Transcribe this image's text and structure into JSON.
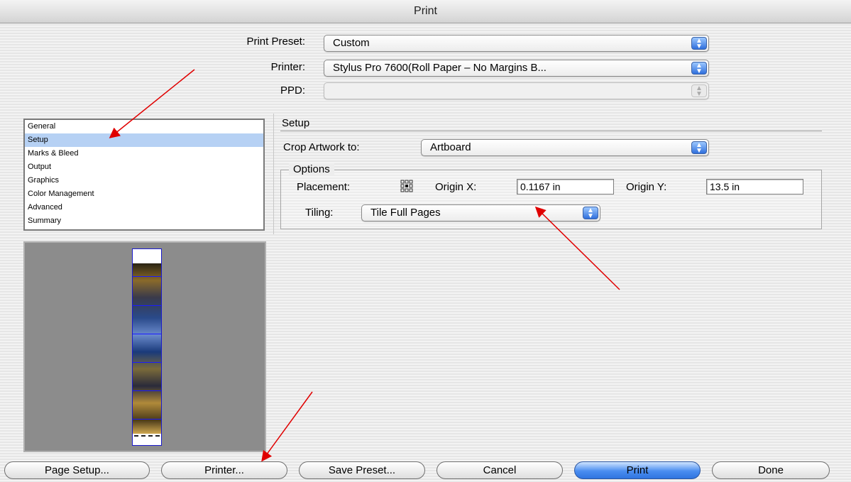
{
  "window": {
    "title": "Print"
  },
  "top": {
    "preset_label": "Print Preset:",
    "preset_value": "Custom",
    "printer_label": "Printer:",
    "printer_value": "Stylus Pro 7600(Roll Paper – No Margins B...",
    "ppd_label": "PPD:",
    "ppd_value": ""
  },
  "sidebar": {
    "items": [
      {
        "label": "General"
      },
      {
        "label": "Setup",
        "selected": true
      },
      {
        "label": "Marks & Bleed"
      },
      {
        "label": "Output"
      },
      {
        "label": "Graphics"
      },
      {
        "label": "Color Management"
      },
      {
        "label": "Advanced"
      },
      {
        "label": "Summary"
      }
    ]
  },
  "setup": {
    "title": "Setup",
    "crop_label": "Crop Artwork to:",
    "crop_value": "Artboard",
    "options_title": "Options",
    "placement_label": "Placement:",
    "origin_x_label": "Origin X:",
    "origin_x_value": "0.1167 in",
    "origin_y_label": "Origin Y:",
    "origin_y_value": "13.5 in",
    "tiling_label": "Tiling:",
    "tiling_value": "Tile Full Pages"
  },
  "buttons": {
    "page_setup": "Page Setup...",
    "printer": "Printer...",
    "save_preset": "Save Preset...",
    "cancel": "Cancel",
    "print": "Print",
    "done": "Done"
  },
  "colors": {
    "selection": "#b6d1f4",
    "aqua_blue": "#2f74e0",
    "annotation_arrow": "#e00000",
    "preview_bg": "#8c8c8c"
  },
  "icons": {
    "popup_arrows": "up-down-arrows-icon",
    "placement": "placement-grid-icon"
  }
}
